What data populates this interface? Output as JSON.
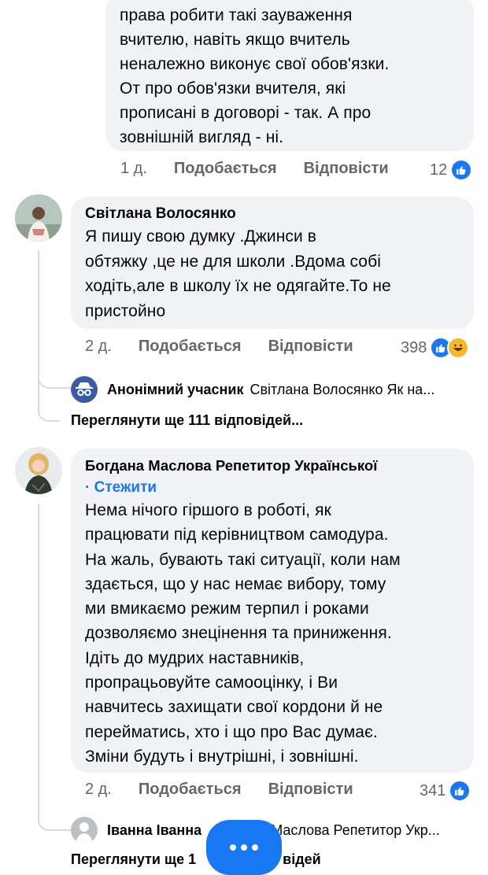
{
  "comment1": {
    "text": "права робити такі зауваження\nвчителю, навіть якщо вчитель\nненалежно виконує свої обов'язки.\nОт про обов'язки вчителя, які\nпрописані в договорі - так. А про\nзовнішній вигляд - ні.",
    "time": "1 д.",
    "like_label": "Подобається",
    "reply_label": "Відповісти",
    "reaction_count": "12"
  },
  "comment2": {
    "author": "Світлана Волосянко",
    "text": "Я пишу свою думку .Джинси в\nобтяжку ,це не для школи .Вдома собі\nходіть,але в школу їх не одягайте.То не\nпристойно",
    "time": "2 д.",
    "like_label": "Подобається",
    "reply_label": "Відповісти",
    "reaction_count": "398",
    "reply_preview": {
      "author": "Анонімний учасник",
      "text": "Світлана Волосянко Як на..."
    },
    "view_more": "Переглянути ще 111 відповідей..."
  },
  "comment3": {
    "author": "Богдана Маслова Репетитор Української",
    "follow": "· Стежити",
    "text": "Нема нічого гіршого в роботі, як\nпрацювати під керівництвом самодура.\nНа жаль, бувають такі ситуації, коли нам\nздається, що  у нас немає вибору, тому\nми вмикаємо режим терпил і роками\nдозволяємо знецінення та приниження.\nІдіть до мудрих наставників,\nпропрацьовуйте самооцінку, і Ви\nнавчитесь захищати свої кордони й не\nперейматись, хто і що про Вас думає.\nЗміни будуть і внутрішні, і зовнішні.",
    "time": "2 д.",
    "like_label": "Подобається",
    "reply_label": "Відповісти",
    "reaction_count": "341",
    "reply_preview": {
      "author": "Іванна Іванна",
      "text": "Маслова Репетитор Укр..."
    },
    "view_more": "Переглянути ще 1",
    "view_more_tail": "відей"
  },
  "colors": {
    "accent": "#1877f2",
    "bubble": "#f0f2f5",
    "meta": "#65676b"
  },
  "icons": {
    "like": "thumbs-up-icon",
    "haha": "haha-icon",
    "more": "more-dots-icon"
  }
}
